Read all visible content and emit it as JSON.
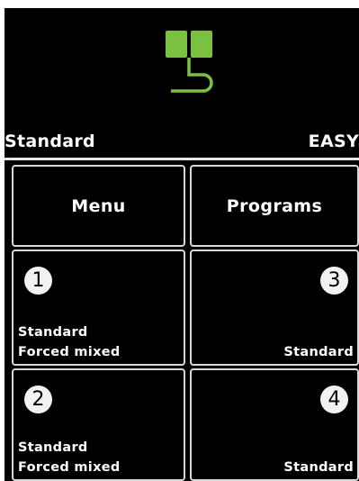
{
  "header": {
    "mode": "Standard",
    "level": "EASY"
  },
  "logo": {
    "icon": "green-plug-logo",
    "color": "#7ac142"
  },
  "buttons": {
    "menu": "Menu",
    "programs": "Programs"
  },
  "slots": [
    {
      "number": "1",
      "line1": "Standard",
      "line2": "Forced mixed"
    },
    {
      "number": "3",
      "line1": "",
      "line2": "Standard"
    },
    {
      "number": "2",
      "line1": "Standard",
      "line2": "Forced mixed"
    },
    {
      "number": "4",
      "line1": "",
      "line2": "Standard"
    }
  ]
}
